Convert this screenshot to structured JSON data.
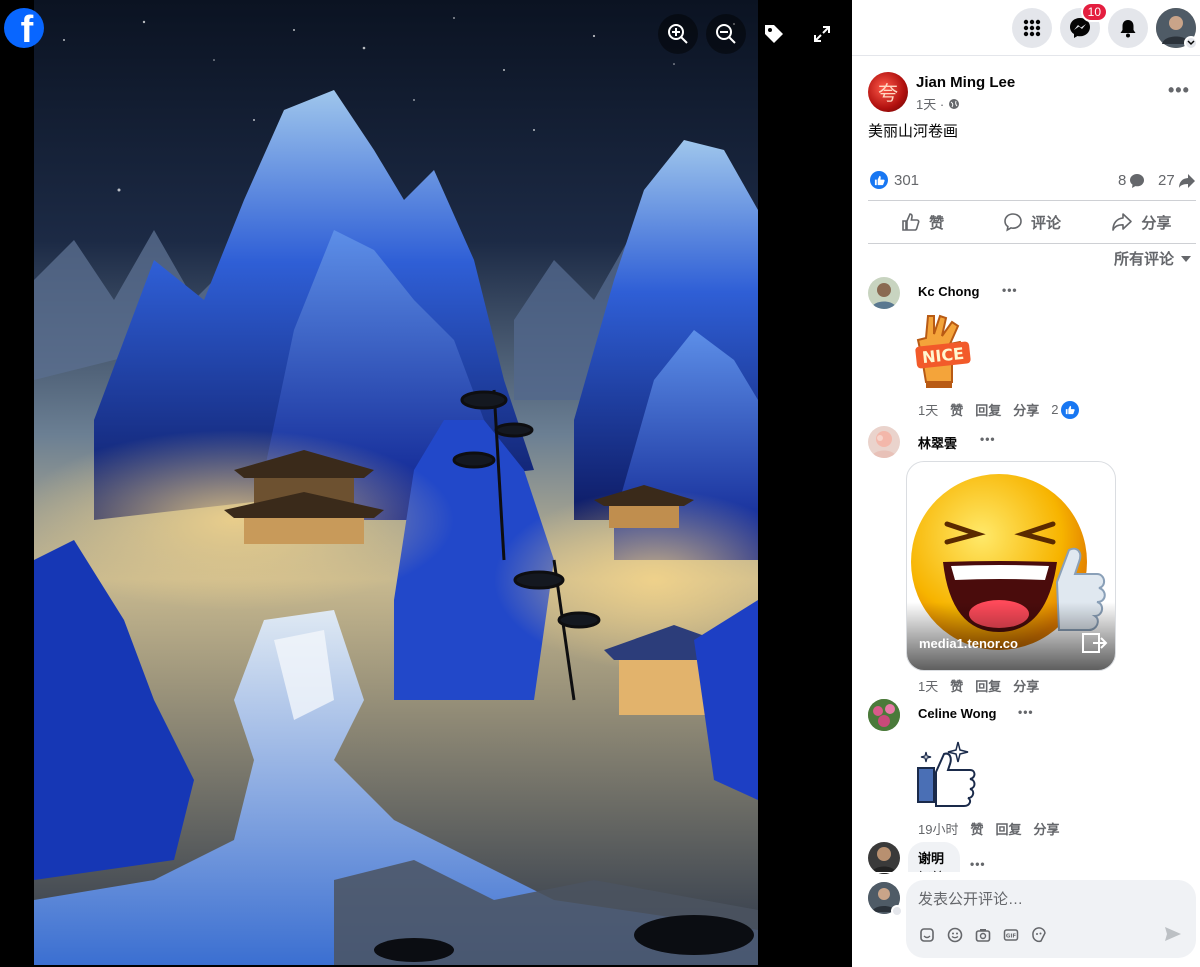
{
  "viewer": {
    "logo_letter": "f",
    "tools": [
      {
        "icon": "zoom-in-icon"
      },
      {
        "icon": "zoom-out-icon"
      },
      {
        "icon": "tag-icon"
      },
      {
        "icon": "fullscreen-icon"
      }
    ]
  },
  "topbar": {
    "menu_icon": "grid-menu-icon",
    "messenger_icon": "messenger-icon",
    "messenger_badge": "10",
    "notifications_icon": "bell-icon",
    "profile_icon": "account-avatar"
  },
  "post": {
    "author": "Jian Ming Lee",
    "time": "1天 ·",
    "privacy_icon": "globe-icon",
    "text": "美丽山河卷画",
    "likes": "301",
    "comments_count": "8",
    "shares_count": "27",
    "like_label": "赞",
    "comment_label": "评论",
    "share_label": "分享",
    "sort_label": "所有评论"
  },
  "comments": [
    {
      "name": "Kc Chong",
      "sticker": "nice-sticker",
      "sticker_text": "NICE",
      "time": "1天",
      "like": "赞",
      "reply": "回复",
      "share": "分享",
      "reactions": "2"
    },
    {
      "name": "林翠雲",
      "gif_source": "media1.tenor.co",
      "time": "1天",
      "like": "赞",
      "reply": "回复",
      "share": "分享"
    },
    {
      "name": "Celine Wong",
      "sticker": "thumbs-up-sticker",
      "time": "19小时",
      "like": "赞",
      "reply": "回复",
      "share": "分享"
    },
    {
      "name": "谢明",
      "text": "好美"
    }
  ],
  "composer": {
    "placeholder": "发表公开评论…",
    "tools": [
      "sticker-icon",
      "emoji-icon",
      "camera-icon",
      "gif-icon",
      "avatar-sticker-icon"
    ],
    "send_icon": "send-icon"
  },
  "colors": {
    "brand": "#0866ff",
    "like": "#1877f2",
    "badge": "#e41e3f"
  }
}
